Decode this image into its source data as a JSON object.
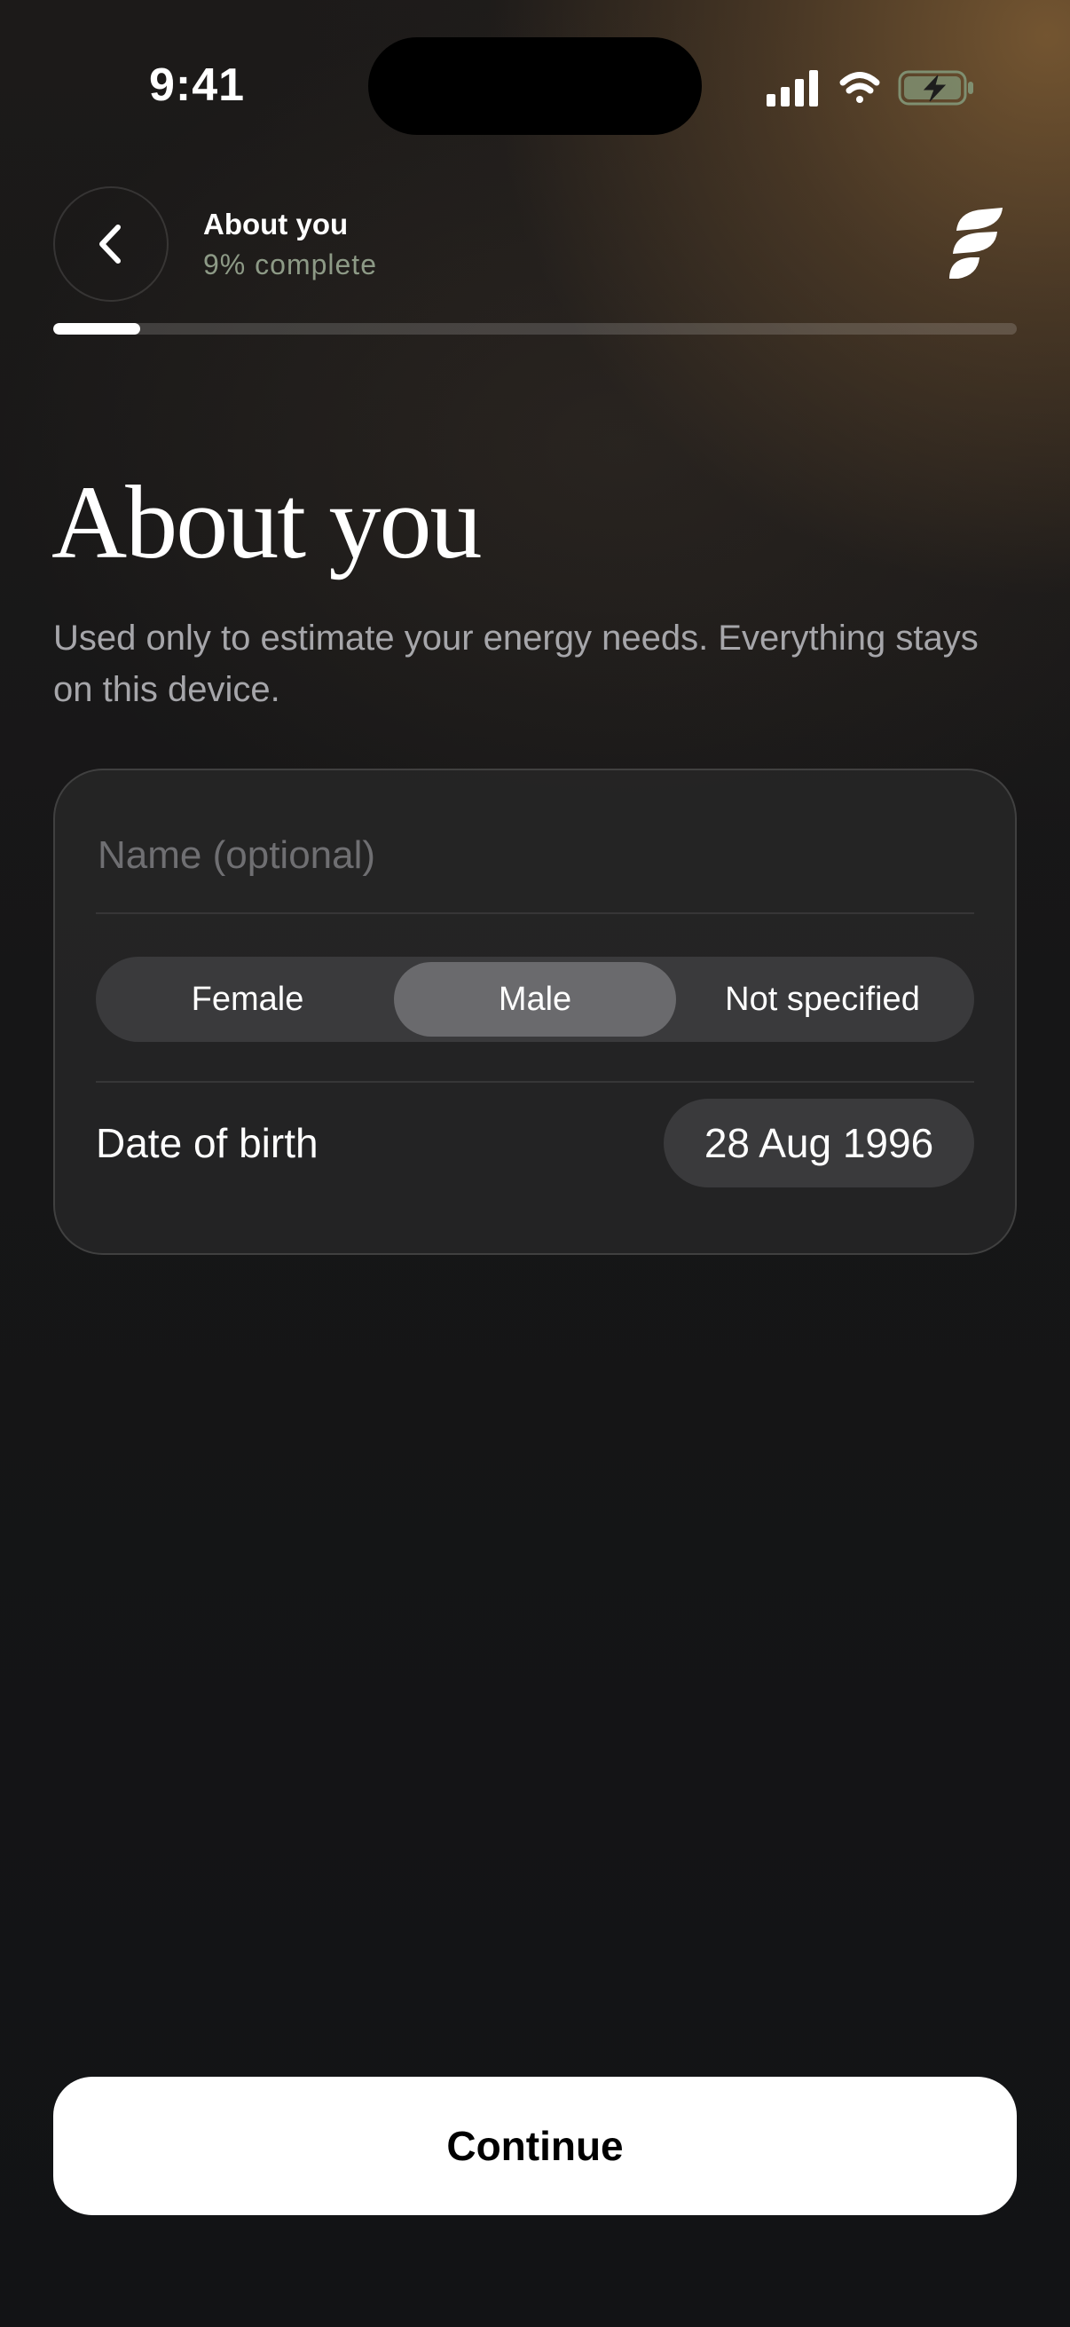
{
  "status_bar": {
    "time": "9:41",
    "icons": [
      "signal-icon",
      "wifi-icon",
      "battery-charging-icon"
    ]
  },
  "header": {
    "title": "About you",
    "subtitle": "9% complete",
    "progress_fraction": 0.09
  },
  "main": {
    "title": "About you",
    "description": "Used only to estimate your energy needs. Everything stays on this device."
  },
  "form": {
    "name_placeholder": "Name (optional)",
    "name_value": "",
    "sex_options": [
      "Female",
      "Male",
      "Not specified"
    ],
    "sex_selected": "Male",
    "dob_label": "Date of birth",
    "dob_value": "28 Aug 1996"
  },
  "footer": {
    "continue_label": "Continue"
  },
  "colors": {
    "accent_green_text": "#8d9a86",
    "card_bg": "#282828",
    "segment_active": "#6a6a6d",
    "button_bg": "#ffffff"
  }
}
